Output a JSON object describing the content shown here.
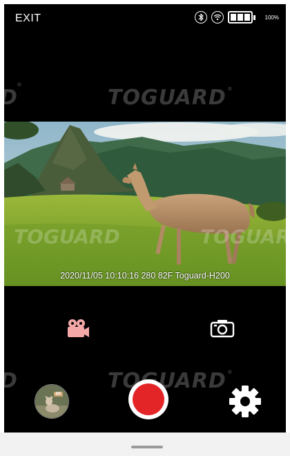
{
  "topbar": {
    "exit_label": "EXIT",
    "battery_text": "100%",
    "icons": [
      "bluetooth-icon",
      "wifi-icon",
      "battery-icon"
    ]
  },
  "watermark": {
    "brand": "TOGUARD",
    "reg": "®",
    "fragment": "D"
  },
  "preview": {
    "osd_text": "2020/11/05 10:10:16 280 82F Toguard-H200",
    "overlay_brand": "TOGUARD"
  },
  "modes": {
    "video_icon": "video-camera-icon",
    "photo_icon": "photo-camera-icon",
    "video_color": "#f4a8a8",
    "photo_color": "#ffffff"
  },
  "controls": {
    "thumbnail_badge": "4K",
    "record_color": "#e32528",
    "record_icon": "record-icon",
    "settings_icon": "gear-icon"
  }
}
